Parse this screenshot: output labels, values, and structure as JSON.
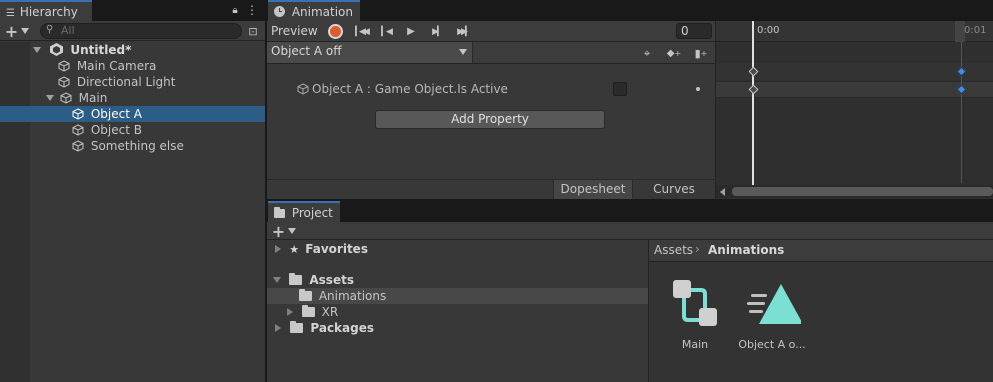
{
  "hierarchy": {
    "tab_label": "Hierarchy",
    "search_placeholder": "All",
    "scene_name": "Untitled*",
    "items": [
      {
        "label": "Main Camera"
      },
      {
        "label": "Directional Light"
      },
      {
        "label": "Main"
      },
      {
        "label": "Object A"
      },
      {
        "label": "Object B"
      },
      {
        "label": "Something else"
      }
    ]
  },
  "animation": {
    "tab_label": "Animation",
    "preview_label": "Preview",
    "frame_value": "0",
    "clip_selected": "Object A off",
    "property_label": "Object A : Game Object.Is Active",
    "add_property_label": "Add Property",
    "dopesheet_label": "Dopesheet",
    "curves_label": "Curves",
    "time_start": "0:00",
    "time_end": "0:01"
  },
  "project": {
    "tab_label": "Project",
    "tree": {
      "favorites": "Favorites",
      "assets": "Assets",
      "animations": "Animations",
      "xr": "XR",
      "packages": "Packages"
    },
    "breadcrumb_root": "Assets",
    "breadcrumb_current": "Animations",
    "assets": [
      {
        "label": "Main",
        "icon": "animator-controller-icon"
      },
      {
        "label": "Object A o...",
        "icon": "animation-clip-icon"
      }
    ]
  },
  "colors": {
    "selection": "#2c5d87",
    "record_red": "#e05a2b",
    "keyframe_blue": "#4a8bd6",
    "asset_teal": "#7be0d3"
  }
}
